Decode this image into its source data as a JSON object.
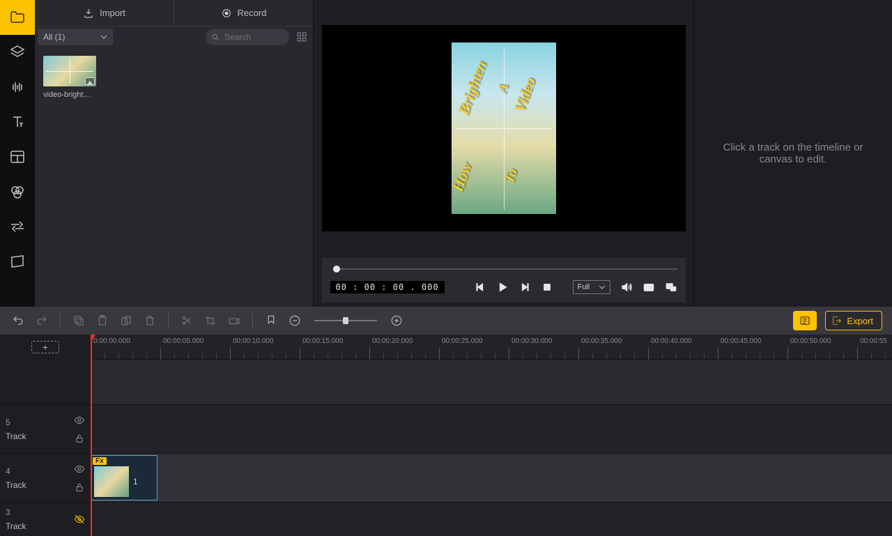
{
  "tabs": {
    "import": "Import",
    "record": "Record"
  },
  "media": {
    "filter": "All (1)",
    "searchPlaceholder": "Search",
    "items": [
      {
        "name": "video-bright…"
      }
    ]
  },
  "preview": {
    "timecode": "00 : 00 : 00 . 000",
    "resolution": "Full",
    "overlay": {
      "brighten": "Brighten",
      "a": "A",
      "video": "Video",
      "how": "How",
      "to": "To"
    }
  },
  "inspector": {
    "hint": "Click a track on the timeline or canvas to edit."
  },
  "toolbar": {
    "export": "Export"
  },
  "timeline": {
    "tracks": [
      {
        "num": "5",
        "label": "Track"
      },
      {
        "num": "4",
        "label": "Track",
        "clipLabel": "1",
        "fx": "Fx"
      },
      {
        "num": "3",
        "label": "Track"
      }
    ],
    "ticks": [
      "0:00:00.000",
      "00:00:05.000",
      "00:00:10.000",
      "00:00:15.000",
      "00:00:20.000",
      "00:00:25.000",
      "00:00:30.000",
      "00:00:35.000",
      "00:00:40.000",
      "00:00:45.000",
      "00:00:50.000",
      "00:00:55"
    ]
  }
}
